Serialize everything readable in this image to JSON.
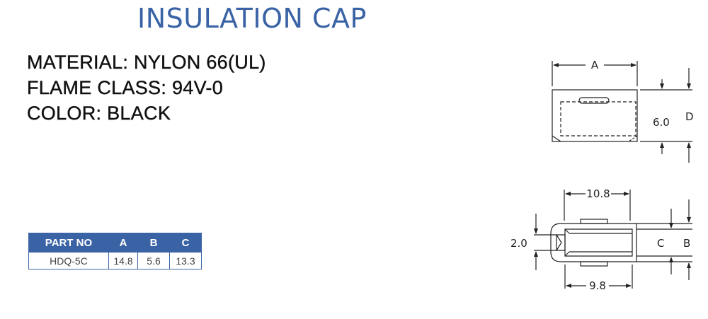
{
  "title": "INSULATION CAP",
  "specs": {
    "material": "MATERIAL: NYLON 66(UL)",
    "flame_class": "FLAME CLASS: 94V-0",
    "color": "COLOR: BLACK"
  },
  "table": {
    "headers": [
      "PART NO",
      "A",
      "B",
      "C"
    ],
    "rows": [
      [
        "HDQ-5C",
        "14.8",
        "5.6",
        "13.3"
      ]
    ]
  },
  "drawing": {
    "label_a": "A",
    "label_d": "D",
    "dim_height": "6.0",
    "dim_top_length": "10.8",
    "dim_bottom_length": "9.8",
    "dim_left": "2.0",
    "label_c": "C",
    "label_b": "B"
  },
  "colors": {
    "accent": "#3a63a6",
    "text": "#111111"
  }
}
